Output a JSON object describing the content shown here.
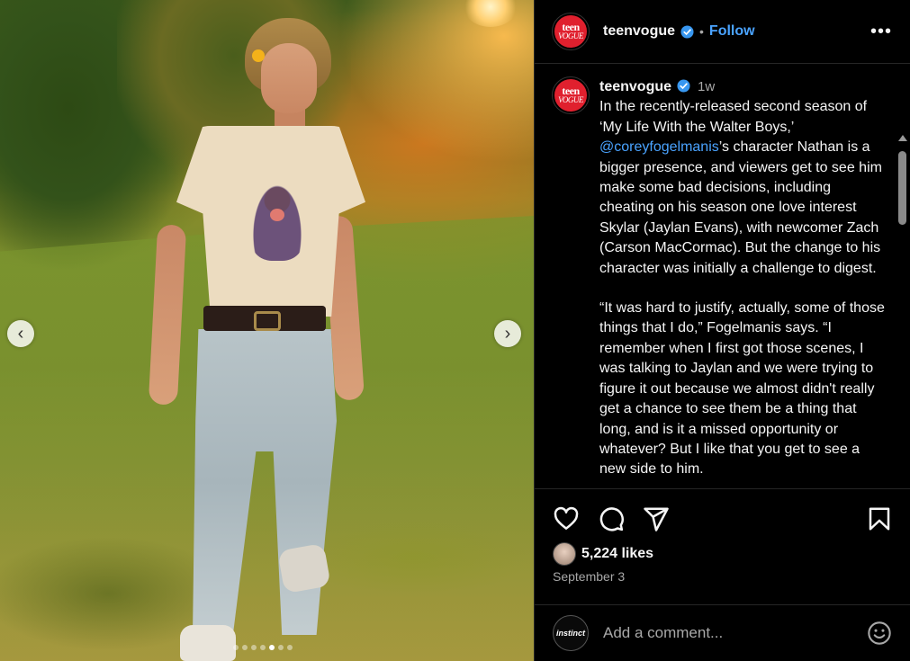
{
  "post": {
    "account": "teenvogue",
    "avatar_line1": "teen",
    "avatar_line2": "VOGUE",
    "follow_label": "Follow",
    "separator": "•",
    "more_label": "•••",
    "posted_ago": "1w",
    "likes": "5,224 likes",
    "date": "September 3"
  },
  "caption": {
    "para1_a": "In the recently-released second season of ‘My Life With the Walter Boys,’ ",
    "mention": "@coreyfogelmanis",
    "para1_b": "’s character Nathan is a bigger presence, and viewers get to see him make some bad decisions, including cheating on his season one love interest Skylar (Jaylan Evans), with newcomer Zach (Carson MacCormac). But the change to his character was initially a challenge to digest.",
    "para2": "“It was hard to justify, actually, some of those things that I do,” Fogelmanis says. “I remember when I first got those scenes, I was talking to Jaylan and we were trying to figure it out because we almost didn't really get a chance to see them be a thing that long, and is it a missed opportunity or whatever? But I like that you get to see a new side to him."
  },
  "carousel": {
    "prev_label": "‹",
    "next_label": "›",
    "slide_count": 7,
    "active_index": 4
  },
  "comment": {
    "placeholder": "Add a comment...",
    "user_avatar_text": "instinct"
  },
  "colors": {
    "accent_link": "#4aa3ff",
    "brand_red": "#e0202e",
    "panel_bg": "#000000"
  },
  "icons": [
    "heart-icon",
    "comment-icon",
    "share-icon",
    "bookmark-icon",
    "verified-icon",
    "emoji-icon",
    "more-icon",
    "chevron-left-icon",
    "chevron-right-icon"
  ]
}
